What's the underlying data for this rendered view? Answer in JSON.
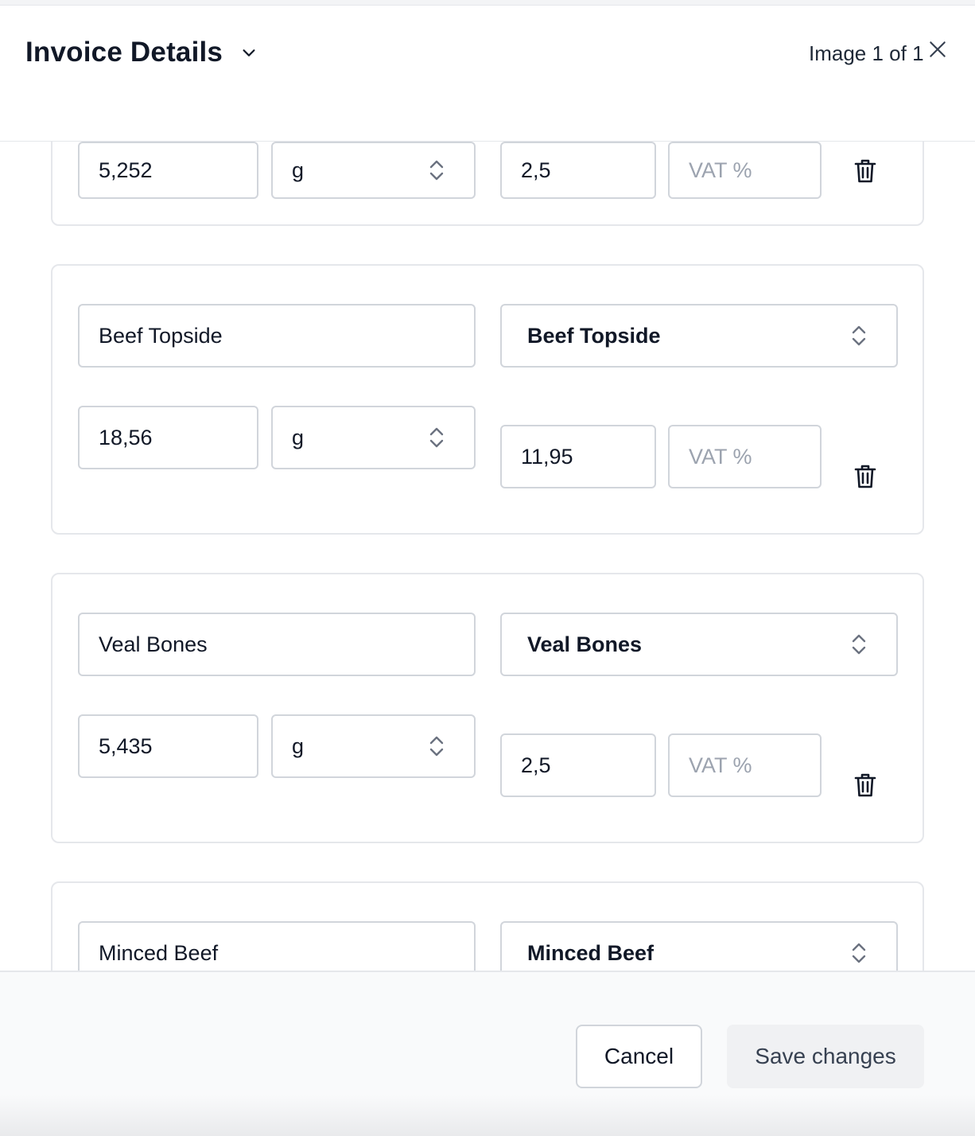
{
  "header": {
    "title": "Invoice Details",
    "image_counter": "Image 1 of 1"
  },
  "items": [
    {
      "quantity": "5,252",
      "unit": "g",
      "price": "2,5",
      "vat_placeholder": "VAT %"
    },
    {
      "description": "Beef Topside",
      "matched_product": "Beef Topside",
      "quantity": "18,56",
      "unit": "g",
      "price": "11,95",
      "vat_placeholder": "VAT %"
    },
    {
      "description": "Veal Bones",
      "matched_product": "Veal Bones",
      "quantity": "5,435",
      "unit": "g",
      "price": "2,5",
      "vat_placeholder": "VAT %"
    },
    {
      "description": "Minced Beef",
      "matched_product": "Minced Beef"
    }
  ],
  "footer": {
    "cancel_label": "Cancel",
    "save_label": "Save changes"
  },
  "colors": {
    "border": "#d1d5db",
    "card_border": "#e5e7eb",
    "placeholder": "#9ca3af",
    "text": "#111827"
  }
}
